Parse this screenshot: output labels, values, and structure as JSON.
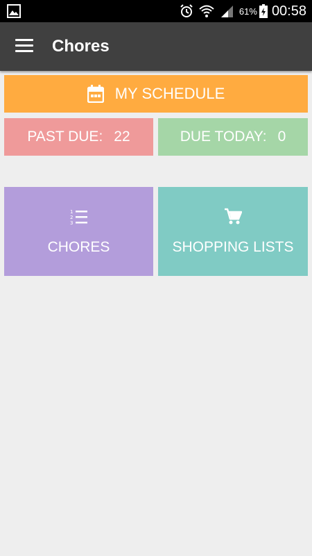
{
  "status_bar": {
    "icons": [
      "image-icon",
      "alarm-icon",
      "wifi-icon",
      "signal-icon",
      "battery-charging-icon"
    ],
    "battery_percent": "61%",
    "time": "00:58"
  },
  "app_bar": {
    "title": "Chores",
    "menu_icon": "hamburger-menu-icon"
  },
  "schedule": {
    "label": "MY SCHEDULE",
    "icon": "calendar-icon",
    "color": "#ffab40"
  },
  "summary": {
    "past_due_label": "PAST DUE:",
    "past_due_count": "22",
    "past_due_color": "#ef9a9a",
    "due_today_label": "DUE TODAY:",
    "due_today_count": "0",
    "due_today_color": "#a5d6a7"
  },
  "tiles": {
    "chores_label": "CHORES",
    "chores_icon": "numbered-list-icon",
    "chores_color": "#b39ddb",
    "shopping_label": "SHOPPING LISTS",
    "shopping_icon": "shopping-cart-icon",
    "shopping_color": "#80cbc4"
  }
}
